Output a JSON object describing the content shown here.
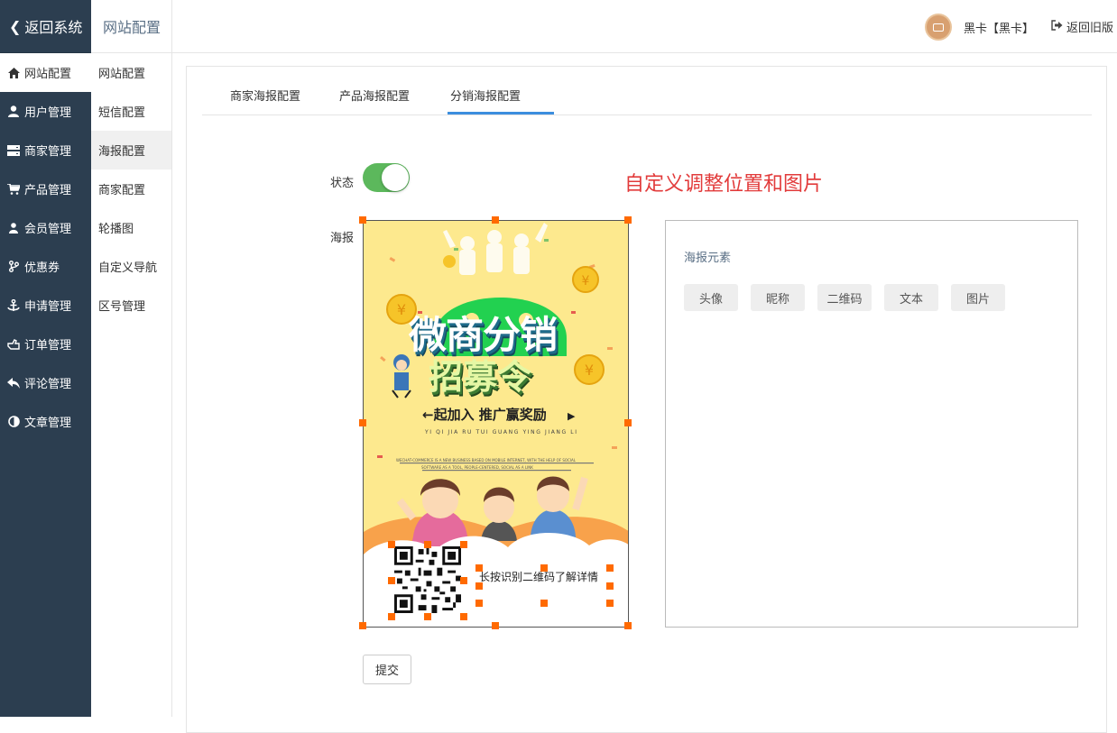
{
  "sidebar": {
    "back_label": "返回系统",
    "items": [
      {
        "label": "网站配置",
        "icon": "home-icon"
      },
      {
        "label": "用户管理",
        "icon": "user-icon"
      },
      {
        "label": "商家管理",
        "icon": "server-icon"
      },
      {
        "label": "产品管理",
        "icon": "cart-icon"
      },
      {
        "label": "会员管理",
        "icon": "users-icon"
      },
      {
        "label": "优惠券",
        "icon": "branch-icon"
      },
      {
        "label": "申请管理",
        "icon": "anchor-icon"
      },
      {
        "label": "订单管理",
        "icon": "hand-icon"
      },
      {
        "label": "评论管理",
        "icon": "reply-icon"
      },
      {
        "label": "文章管理",
        "icon": "contrast-icon"
      }
    ]
  },
  "subnav": {
    "title": "网站配置",
    "items": [
      "网站配置",
      "短信配置",
      "海报配置",
      "商家配置",
      "轮播图",
      "自定义导航",
      "区号管理"
    ]
  },
  "header": {
    "user_name": "黑卡【黑卡】",
    "old_version": "返回旧版"
  },
  "tabs": [
    "商家海报配置",
    "产品海报配置",
    "分销海报配置"
  ],
  "form": {
    "status_label": "状态",
    "poster_label": "海报",
    "hint": "自定义调整位置和图片",
    "submit_label": "提交"
  },
  "poster": {
    "title_line1": "微商分销",
    "title_line2": "招募令",
    "slogan": "起加入 推广赢奖励",
    "pinyin": "YI QI JIA RU TUI GUANG YING JIANG LI",
    "english_1": "WECHAT-COMMERCE IS A NEW BUSINESS BASED ON MOBILE INTERNET, WITH THE HELP OF SOCIAL",
    "english_2": "SOFTWARE AS A TOOL, PEOPLE-CENTERED, SOCIAL AS A LINK",
    "qr_text": "长按识别二维码了解详情"
  },
  "elements": {
    "title": "海报元素",
    "buttons": [
      "头像",
      "昵称",
      "二维码",
      "文本",
      "图片"
    ]
  },
  "colors": {
    "sidebar_bg": "#2c3e50",
    "toggle_on": "#5cb85c",
    "hint_red": "#e23b3b",
    "tab_active": "#3c8ede",
    "handle": "#ff6a00"
  }
}
